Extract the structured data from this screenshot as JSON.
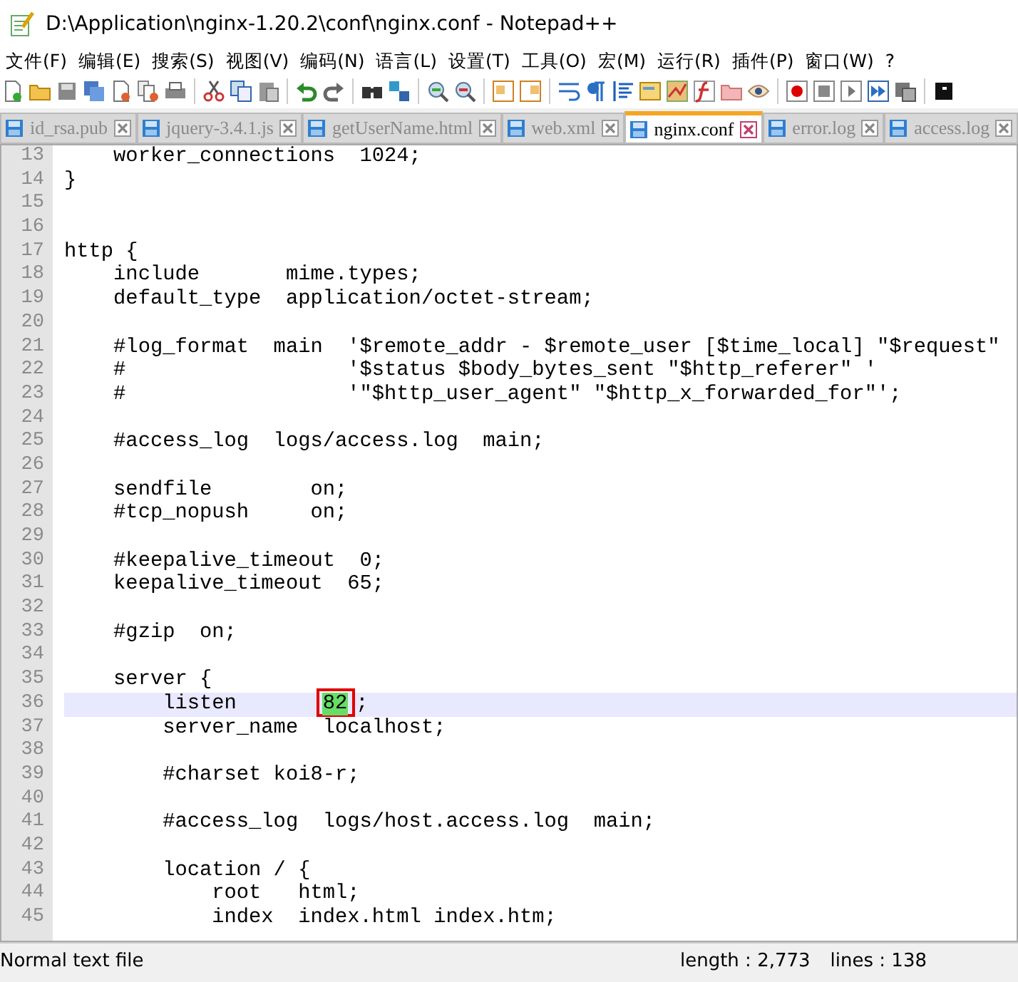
{
  "window": {
    "title": "D:\\Application\\nginx-1.20.2\\conf\\nginx.conf - Notepad++"
  },
  "menu": [
    "文件(F)",
    "编辑(E)",
    "搜索(S)",
    "视图(V)",
    "编码(N)",
    "语言(L)",
    "设置(T)",
    "工具(O)",
    "宏(M)",
    "运行(R)",
    "插件(P)",
    "窗口(W)",
    "?"
  ],
  "tabs": [
    {
      "label": "id_rsa.pub",
      "selected": false
    },
    {
      "label": "jquery-3.4.1.js",
      "selected": false
    },
    {
      "label": "getUserName.html",
      "selected": false
    },
    {
      "label": "web.xml",
      "selected": false
    },
    {
      "label": "nginx.conf",
      "selected": true
    },
    {
      "label": "error.log",
      "selected": false
    },
    {
      "label": "access.log",
      "selected": false
    }
  ],
  "editor": {
    "lines": [
      {
        "number": "13",
        "text": "    worker_connections  1024;",
        "current": false
      },
      {
        "number": "14",
        "text": "}",
        "current": false
      },
      {
        "number": "15",
        "current": false
      },
      {
        "number": "16",
        "current": false
      },
      {
        "number": "17",
        "text": "http {",
        "current": false
      },
      {
        "number": "18",
        "text": "    include       mime.types;",
        "current": false
      },
      {
        "number": "19",
        "text": "    default_type  application/octet-stream;",
        "current": false
      },
      {
        "number": "20",
        "current": false
      },
      {
        "number": "21",
        "text": "    #log_format  main  '$remote_addr - $remote_user [$time_local] \"$request\"",
        "current": false
      },
      {
        "number": "22",
        "text": "    #                  '$status $body_bytes_sent \"$http_referer\" '",
        "current": false
      },
      {
        "number": "23",
        "text": "    #                  '\"$http_user_agent\" \"$http_x_forwarded_for\"';",
        "current": false
      },
      {
        "number": "24",
        "current": false
      },
      {
        "number": "25",
        "text": "    #access_log  logs/access.log  main;",
        "current": false
      },
      {
        "number": "26",
        "current": false
      },
      {
        "number": "27",
        "text": "    sendfile        on;",
        "current": false
      },
      {
        "number": "28",
        "text": "    #tcp_nopush     on;",
        "current": false
      },
      {
        "number": "29",
        "current": false
      },
      {
        "number": "30",
        "text": "    #keepalive_timeout  0;",
        "current": false
      },
      {
        "number": "31",
        "text": "    keepalive_timeout  65;",
        "current": false
      },
      {
        "number": "32",
        "current": false
      },
      {
        "number": "33",
        "text": "    #gzip  on;",
        "current": false
      },
      {
        "number": "34",
        "current": false
      },
      {
        "number": "35",
        "text": "    server {",
        "current": false
      },
      {
        "number": "36",
        "text": "        listen       ",
        "match": "82",
        "rest": ";",
        "current": true
      },
      {
        "number": "37",
        "text": "        server_name  localhost;",
        "current": false
      },
      {
        "number": "38",
        "current": false
      },
      {
        "number": "39",
        "text": "        #charset koi8-r;",
        "current": false
      },
      {
        "number": "40",
        "current": false
      },
      {
        "number": "41",
        "text": "        #access_log  logs/host.access.log  main;",
        "current": false
      },
      {
        "number": "42",
        "current": false
      },
      {
        "number": "43",
        "text": "        location / {",
        "current": false
      },
      {
        "number": "44",
        "text": "            root   html;",
        "current": false
      },
      {
        "number": "45",
        "text": "            index  index.html index.htm;",
        "current": false
      }
    ]
  },
  "status_bar": {
    "file_type": "Normal text file",
    "length": "length : 2,773",
    "lines": "lines : 138"
  }
}
